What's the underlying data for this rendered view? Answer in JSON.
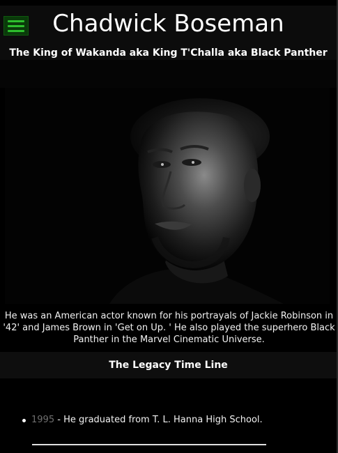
{
  "header": {
    "menu_icon": "hamburger-menu-icon",
    "title": "Chadwick Boseman",
    "subtitle": "The King of Wakanda aka King T'Challa aka Black Panther"
  },
  "portrait": {
    "subject": "Chadwick Boseman portrait"
  },
  "bio": {
    "text": "He was an American actor known for his portrayals of Jackie Robinson in '42' and James Brown in 'Get on Up. ' He also played the superhero Black Panther in the Marvel Cinematic Universe."
  },
  "legacy": {
    "heading": "The Legacy Time Line",
    "items": [
      {
        "year": "1995",
        "separator": " - ",
        "text": "He graduated from T. L. Hanna High School."
      }
    ]
  },
  "colors": {
    "background": "#000000",
    "menu_green": "#2dbf2d",
    "year_gray": "#6f6f6f"
  }
}
